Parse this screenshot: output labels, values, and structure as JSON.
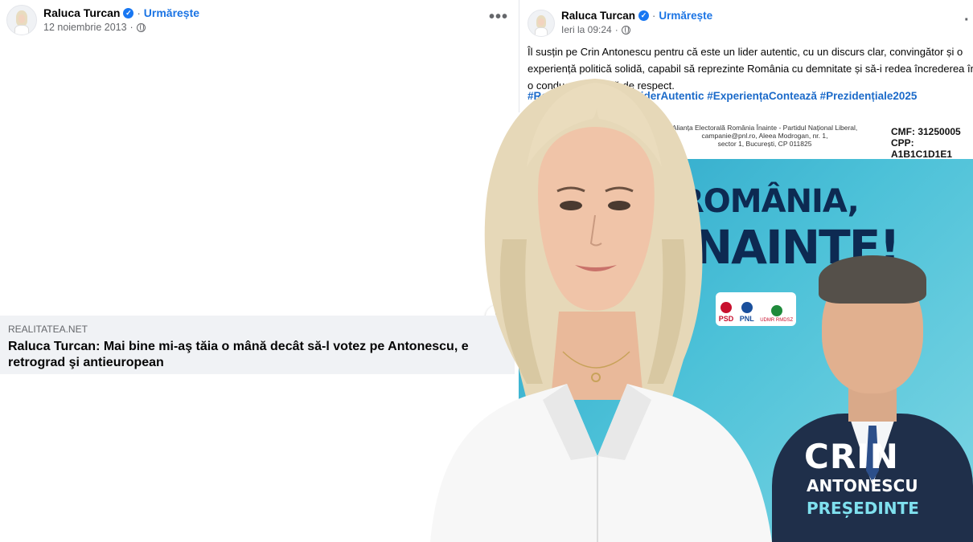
{
  "left_post": {
    "author": "Raluca Turcan",
    "verified_icon": "verified-badge-icon",
    "follow_label": "Urmărește",
    "date": "12 noiembrie 2013",
    "separator": "·",
    "privacy_icon": "globe-icon",
    "more_label": "•••",
    "link_card": {
      "domain": "REALITATEA.NET",
      "title": "Raluca Turcan: Mai bine mi-aş tăia o mână decât să-l votez pe Antonescu, e retrograd şi antieuropean",
      "info_label": "i"
    }
  },
  "right_post": {
    "author": "Raluca Turcan",
    "follow_label": "Urmărește",
    "date": "Ieri la 09:24",
    "separator": "·",
    "text_line1": "Îl susțin pe Crin Antonescu pentru că este un lider autentic, cu un discurs clar, convingător și o",
    "text_line2": "experiență politică solidă, capabil să reprezinte România cu demnitate și să-i redea încrederea într",
    "text_line3": "o conducere demnă de respect.",
    "hashtags": "#RomâniaAreViitor #LiderAutentic #ExperiențaContează #Prezidențiale2025",
    "poster": {
      "legal_line1": "Alianța Electorală România Înainte - Partidul Național Liberal,",
      "legal_line2": "campanie@pnl.ro, Aleea Modrogan, nr. 1,",
      "legal_line3": "sector 1, București, CP 011825",
      "cmf": "CMF: 31250005",
      "cpp": "CPP: A1B1C1D1E1",
      "slogan_line1": "ROMÂNIA,",
      "slogan_line2": "ÎNAINTE!",
      "party1": "PSD",
      "party2": "PNL",
      "party3": "UDMR RMDSZ",
      "candidate_first": "CRIN",
      "candidate_last": "ANTONESCU",
      "candidate_role": "PREȘEDINTE"
    }
  },
  "colors": {
    "facebook_blue": "#1b74e4",
    "poster_cyan": "#4cc1d8",
    "poster_navy": "#0d2a52"
  }
}
